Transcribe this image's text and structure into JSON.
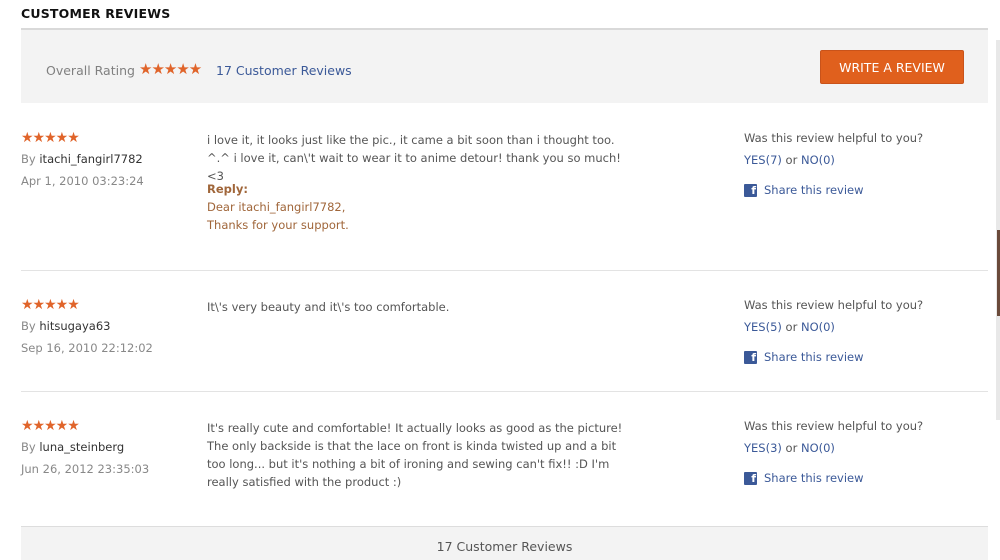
{
  "section": {
    "title": "CUSTOMER REVIEWS"
  },
  "summary": {
    "overall_label": "Overall Rating",
    "overall_stars": "★★★★★",
    "review_count_link": "17 Customer Reviews",
    "write_review_button": "WRITE A REVIEW"
  },
  "colors": {
    "accent_orange": "#e0601d",
    "star_orange": "#e0642a",
    "link_blue": "#3b5998",
    "reply_brown": "#a0663a"
  },
  "reviews": [
    {
      "stars": "★★★★★",
      "by_label": "By",
      "author": "itachi_fangirl7782",
      "date": "Apr 1, 2010 03:23:24",
      "text": "i love it, it looks just like the pic., it came a bit soon than i thought too. ^.^ i love it, can\\'t wait to wear it to anime detour! thank you so much! <3",
      "reply_label": "Reply:",
      "reply_lines": [
        "Dear itachi_fangirl7782,",
        "Thanks for your support."
      ],
      "helpful_question": "Was this review helpful to you?",
      "yes_label": "YES(7)",
      "or_label": "or",
      "no_label": "NO(0)",
      "share_label": "Share this review"
    },
    {
      "stars": "★★★★★",
      "by_label": "By",
      "author": "hitsugaya63",
      "date": "Sep 16, 2010 22:12:02",
      "text": "It\\'s very beauty and it\\'s too comfortable.",
      "helpful_question": "Was this review helpful to you?",
      "yes_label": "YES(5)",
      "or_label": "or",
      "no_label": "NO(0)",
      "share_label": "Share this review"
    },
    {
      "stars": "★★★★★",
      "by_label": "By",
      "author": "luna_steinberg",
      "date": "Jun 26, 2012 23:35:03",
      "text": "It's really cute and comfortable! It actually looks as good as the picture! The only backside is that the lace on front is kinda twisted up and a bit too long... but it's nothing a bit of ironing and sewing can't fix!! :D I'm really satisfied with the product :)",
      "helpful_question": "Was this review helpful to you?",
      "yes_label": "YES(3)",
      "or_label": "or",
      "no_label": "NO(0)",
      "share_label": "Share this review"
    }
  ],
  "footer": {
    "review_count": "17 Customer Reviews"
  },
  "icons": {
    "facebook": "facebook-icon"
  }
}
